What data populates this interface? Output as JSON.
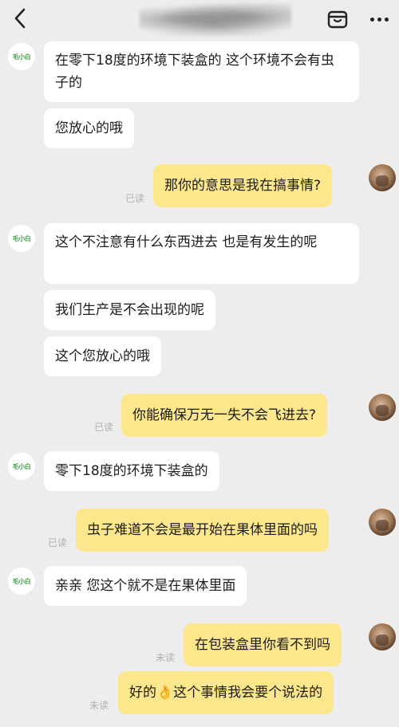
{
  "header": {
    "back_icon": "chevron-left-icon",
    "shop_icon": "shop-icon",
    "more_icon": "more-dots-icon"
  },
  "brand": {
    "avatar_text": "毛小白",
    "accent": "#3fa24a"
  },
  "colors": {
    "background": "#ededed",
    "incoming_bubble": "#ffffff",
    "outgoing_bubble": "#fde78d",
    "status_text": "#b0b0b0"
  },
  "messages": [
    {
      "side": "in",
      "text": "在零下18度的环境下装盒的 这个环境不会有虫子的"
    },
    {
      "side": "in",
      "text": "您放心的哦"
    },
    {
      "side": "out",
      "text": "那你的意思是我在搞事情?",
      "status": "已读"
    },
    {
      "side": "in",
      "text": "这个不注意有什么东西进去 也是有发生的呢"
    },
    {
      "side": "in",
      "text": "我们生产是不会出现的呢"
    },
    {
      "side": "in",
      "text": "这个您放心的哦"
    },
    {
      "side": "out",
      "text": "你能确保万无一失不会飞进去?",
      "status": "已读"
    },
    {
      "side": "in",
      "text": "零下18度的环境下装盒的"
    },
    {
      "side": "out",
      "text": "虫子难道不会是最开始在果体里面的吗",
      "status": "已读"
    },
    {
      "side": "in",
      "text": "亲亲 您这个就不是在果体里面"
    },
    {
      "side": "out",
      "text": "在包装盒里你看不到吗",
      "status": "未读"
    },
    {
      "side": "out",
      "text": "好的👌这个事情我会要个说法的",
      "status": "未读"
    }
  ]
}
